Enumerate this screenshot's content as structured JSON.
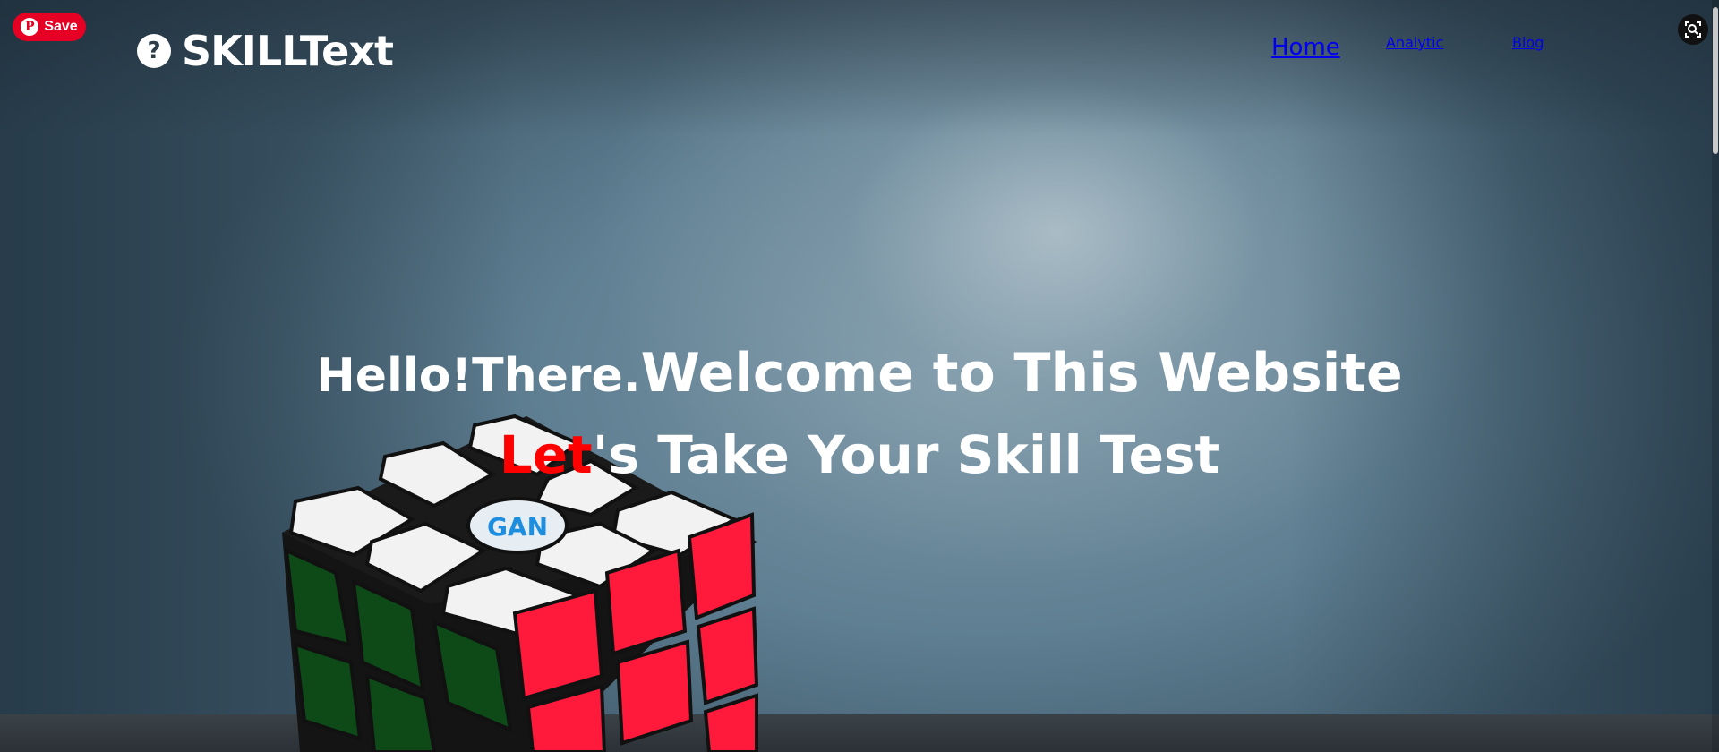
{
  "pinterest": {
    "save_label": "Save",
    "icon": "pinterest-icon"
  },
  "logo": {
    "text": "SKILLText",
    "icon": "question-circle-icon"
  },
  "nav": {
    "home": "Home",
    "analytic": "Analytic",
    "blog": "Blog"
  },
  "hero": {
    "line1_part1": "Hello!There.",
    "line1_part2": "Welcome to This Website",
    "line2_accent": "Let",
    "line2_rest": "'s Take Your Skill Test",
    "accent_color": "#ff0000"
  },
  "cube": {
    "logo_text": "GAN"
  },
  "lens": {
    "icon": "visual-search-icon"
  },
  "colors": {
    "nav_text": "#f3d9a4",
    "pin_red": "#e60023"
  }
}
